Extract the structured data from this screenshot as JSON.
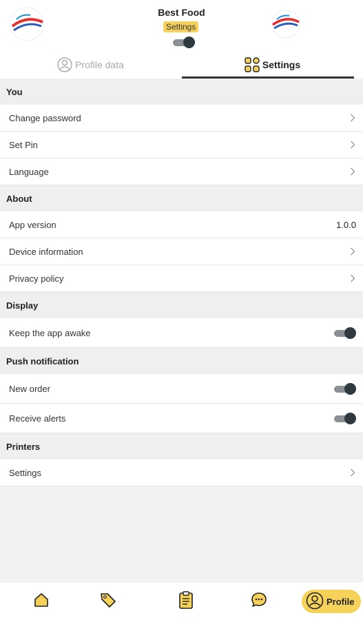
{
  "header": {
    "store_name": "Best Food",
    "badge": "Settings",
    "toggle_on": true
  },
  "tabs": [
    {
      "label": "Profile data",
      "active": false
    },
    {
      "label": "Settings",
      "active": true
    }
  ],
  "sections": {
    "you": {
      "title": "You",
      "items": [
        {
          "label": "Change password"
        },
        {
          "label": "Set Pin"
        },
        {
          "label": "Language"
        }
      ]
    },
    "about": {
      "title": "About",
      "items": [
        {
          "label": "App version",
          "value": "1.0.0"
        },
        {
          "label": "Device information"
        },
        {
          "label": "Privacy policy"
        }
      ]
    },
    "display": {
      "title": "Display",
      "items": [
        {
          "label": "Keep the app awake",
          "enabled": true
        }
      ]
    },
    "push": {
      "title": "Push notification",
      "items": [
        {
          "label": "New order",
          "enabled": true
        },
        {
          "label": "Receive alerts",
          "enabled": true
        }
      ]
    },
    "printers": {
      "title": "Printers",
      "items": [
        {
          "label": "Settings"
        }
      ]
    }
  },
  "bottom_nav": {
    "items": [
      "home-icon",
      "tag-icon",
      "clipboard-icon",
      "chat-icon"
    ],
    "active_label": "Profile"
  },
  "colors": {
    "accent": "#f7d25a",
    "toggle_knob": "#2f3a40",
    "toggle_track": "#8a9095",
    "section_bg": "#efefef"
  }
}
